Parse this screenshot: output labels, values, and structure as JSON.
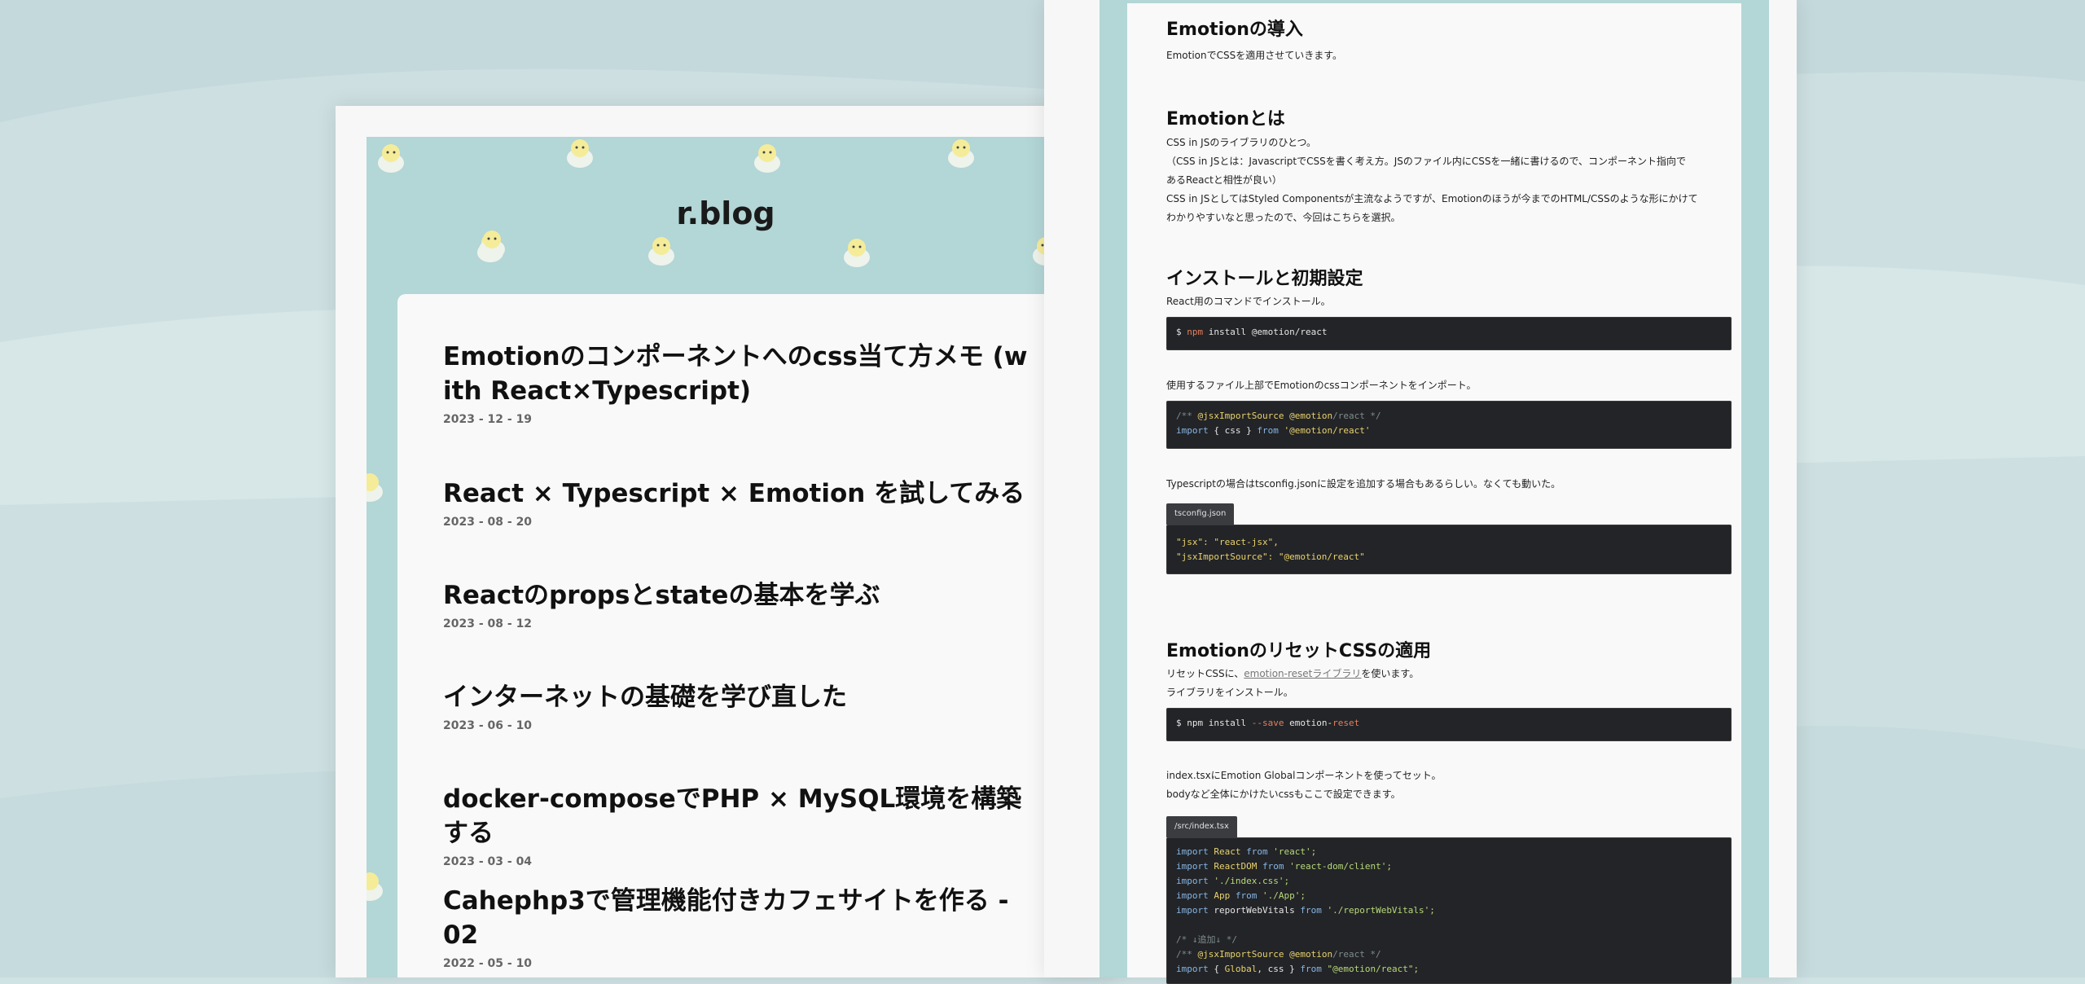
{
  "blog": {
    "title": "r.blog",
    "posts": [
      {
        "title": "Emotionのコンポーネントへのcss当て方メモ (with React×Typescript)",
        "date": "2023 - 12 - 19"
      },
      {
        "title": "React × Typescript × Emotion を試してみる",
        "date": "2023 - 08 - 20"
      },
      {
        "title": "Reactのpropsとstateの基本を学ぶ",
        "date": "2023 - 08 - 12"
      },
      {
        "title": "インターネットの基礎を学び直した",
        "date": "2023 - 06 - 10"
      },
      {
        "title": "docker-composeでPHP × MySQL環境を構築する",
        "date": "2023 - 03 - 04"
      },
      {
        "title": "Cahephp3で管理機能付きカフェサイトを作る - 02",
        "date": "2022 - 05 - 10"
      }
    ]
  },
  "article": {
    "h_intro": "Emotionの導入",
    "p_intro": "EmotionでCSSを適用させていきます。",
    "h_what": "Emotionとは",
    "p_what_1": "CSS in JSのライブラリのひとつ。",
    "p_what_2": "（CSS in JSとは：JavascriptでCSSを書く考え方。JSのファイル内にCSSを一緒に書けるので、コンポーネント指向で",
    "p_what_3": "あるReactと相性が良い）",
    "p_what_4": "CSS in JSとしてはStyled Componentsが主流なようですが、Emotionのほうが今までのHTML/CSSのような形にかけて",
    "p_what_5": "わかりやすいなと思ったので、今回はこちらを選択。",
    "h_install": "インストールと初期設定",
    "p_install": "React用のコマンドでインストール。",
    "code_install": {
      "prompt": "$",
      "cmd": "npm",
      "rest": "install @emotion/react"
    },
    "p_import": "使用するファイル上部でEmotionのcssコンポーネントをインポート。",
    "code_import": {
      "l1_a": "/** ",
      "l1_b": "@jsxImportSource @emotion",
      "l1_c": "/react */",
      "l2_a": "import",
      "l2_b": " { css } ",
      "l2_c": "from",
      "l2_d": " '@emotion/react'"
    },
    "p_tsconfig": "Typescriptの場合はtsconfig.jsonに設定を追加する場合もあるらしい。なくても動いた。",
    "file_tsconfig": "tsconfig.json",
    "code_tsconfig": {
      "l1": "\"jsx\": \"react-jsx\",",
      "l2": "\"jsxImportSource\": \"@emotion/react\""
    },
    "h_reset": "EmotionのリセットCSSの適用",
    "p_reset_1a": "リセットCSSに、",
    "p_reset_link": "emotion-resetライブラリ",
    "p_reset_1b": "を使います。",
    "p_reset_2": "ライブラリをインストール。",
    "code_reset": {
      "a": "$ npm install ",
      "b": "--save",
      "c": " emotion-",
      "d": "reset"
    },
    "p_global_1": "index.tsxにEmotion Globalコンポーネントを使ってセット。",
    "p_global_2": "bodyなど全体にかけたいcssもここで設定できます。",
    "file_index": "/src/index.tsx",
    "code_index": {
      "l1a": "import",
      "l1b": " React ",
      "l1c": "from",
      "l1d": " 'react';",
      "l2a": "import",
      "l2b": " ReactDOM ",
      "l2c": "from",
      "l2d": " 'react-dom/client';",
      "l3a": "import",
      "l3b": " './index.css';",
      "l4a": "import",
      "l4b": " App ",
      "l4c": "from",
      "l4d": " './App';",
      "l5a": "import",
      "l5b": " reportWebVitals ",
      "l5c": "from",
      "l5d": " './reportWebVitals';",
      "l6": "/* ↓追加↓ */",
      "l7a": "/** ",
      "l7b": "@jsxImportSource @emotion",
      "l7c": "/react */",
      "l8a": "import",
      "l8b": " { ",
      "l8c": "Global",
      "l8d": ", css } ",
      "l8e": "from",
      "l8f": " \"@emotion/react\";"
    }
  }
}
